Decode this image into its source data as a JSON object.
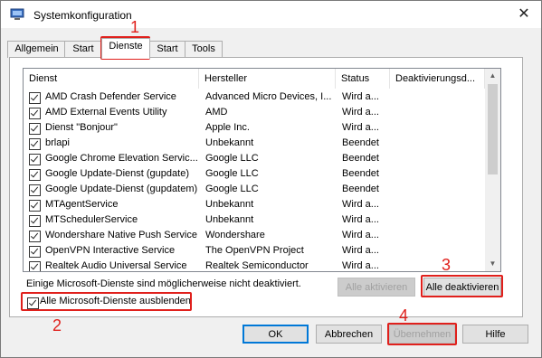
{
  "window": {
    "title": "Systemkonfiguration",
    "close_symbol": "✕"
  },
  "tabs": [
    {
      "label": "Allgemein"
    },
    {
      "label": "Start"
    },
    {
      "label": "Dienste"
    },
    {
      "label": "Start"
    },
    {
      "label": "Tools"
    }
  ],
  "list": {
    "columns": [
      "Dienst",
      "Hersteller",
      "Status",
      "Deaktivierungsd..."
    ],
    "rows": [
      {
        "service": "AMD Crash Defender Service",
        "vendor": "Advanced Micro Devices, I...",
        "status": "Wird a..."
      },
      {
        "service": "AMD External Events Utility",
        "vendor": "AMD",
        "status": "Wird a..."
      },
      {
        "service": "Dienst \"Bonjour\"",
        "vendor": "Apple Inc.",
        "status": "Wird a..."
      },
      {
        "service": "brlapi",
        "vendor": "Unbekannt",
        "status": "Beendet"
      },
      {
        "service": "Google Chrome Elevation Servic...",
        "vendor": "Google LLC",
        "status": "Beendet"
      },
      {
        "service": "Google Update-Dienst (gupdate)",
        "vendor": "Google LLC",
        "status": "Beendet"
      },
      {
        "service": "Google Update-Dienst (gupdatem)",
        "vendor": "Google LLC",
        "status": "Beendet"
      },
      {
        "service": "MTAgentService",
        "vendor": "Unbekannt",
        "status": "Wird a..."
      },
      {
        "service": "MTSchedulerService",
        "vendor": "Unbekannt",
        "status": "Wird a..."
      },
      {
        "service": "Wondershare Native Push Service",
        "vendor": "Wondershare",
        "status": "Wird a..."
      },
      {
        "service": "OpenVPN Interactive Service",
        "vendor": "The OpenVPN Project",
        "status": "Wird a..."
      },
      {
        "service": "Realtek Audio Universal Service",
        "vendor": "Realtek Semiconductor",
        "status": "Wird a..."
      }
    ]
  },
  "note": "Einige Microsoft-Dienste sind möglicherweise nicht deaktiviert.",
  "buttons": {
    "enable_all": "Alle aktivieren",
    "disable_all": "Alle deaktivieren",
    "ok": "OK",
    "cancel": "Abbrechen",
    "apply": "Übernehmen",
    "help": "Hilfe"
  },
  "hide_ms_label": "Alle Microsoft-Dienste ausblenden",
  "annotations": [
    "1",
    "2",
    "3",
    "4"
  ],
  "colors": {
    "highlight": "#e0201c",
    "accent": "#0078d7"
  }
}
